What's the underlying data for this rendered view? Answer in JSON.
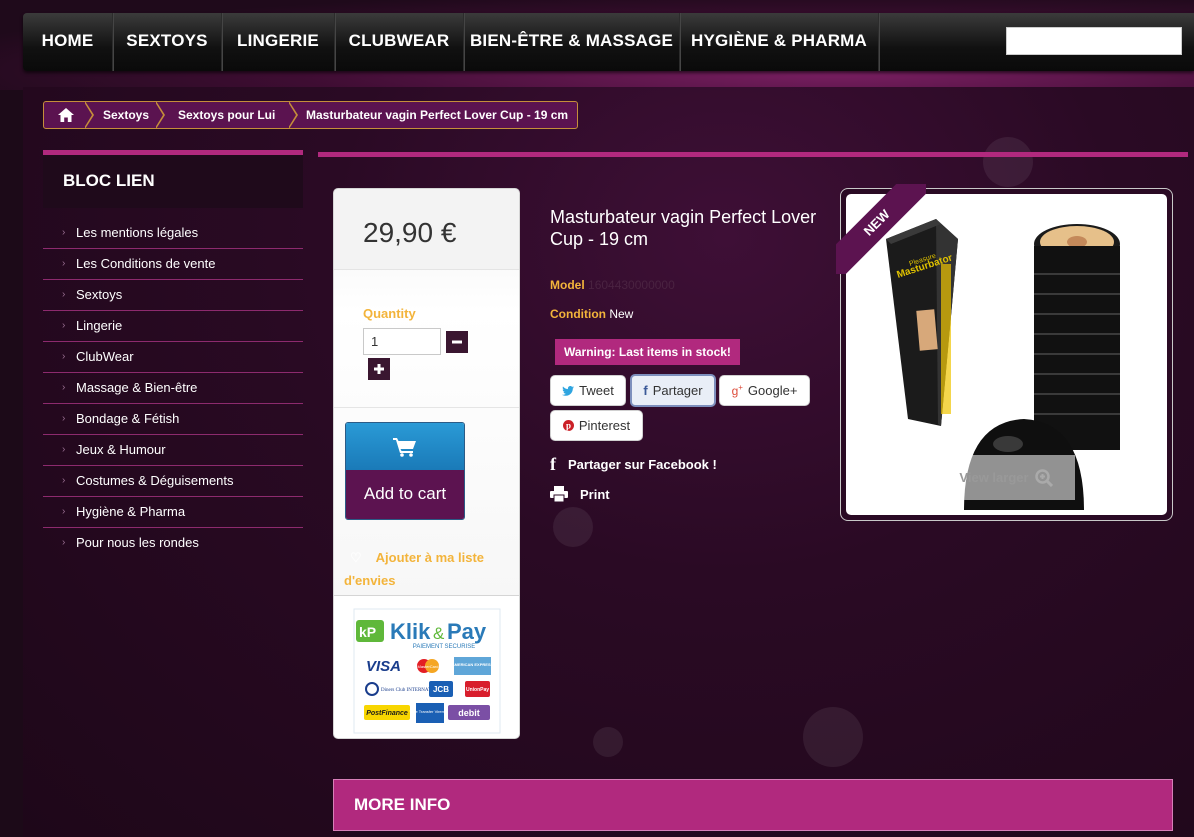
{
  "nav": {
    "items": [
      "HOME",
      "SEXTOYS",
      "LINGERIE",
      "CLUBWEAR",
      "BIEN-ÊTRE & MASSAGE",
      "HYGIÈNE & PHARMA"
    ],
    "search_value": ""
  },
  "breadcrumb": {
    "items": [
      "Sextoys",
      "Sextoys pour Lui",
      "Masturbateur vagin Perfect Lover Cup - 19 cm"
    ]
  },
  "sidebar": {
    "title": "BLOC LIEN",
    "links": [
      "Les mentions légales",
      "Les Conditions de vente",
      "Sextoys",
      "Lingerie",
      "ClubWear",
      "Massage & Bien-être",
      "Bondage & Fétish",
      "Jeux & Humour",
      "Costumes & Déguisements",
      "Hygiène & Pharma",
      "Pour nous les rondes"
    ]
  },
  "buy": {
    "price": "29,90 €",
    "quantity_label": "Quantity",
    "quantity_value": "1",
    "add_to_cart": "Add to cart",
    "wishlist": "Ajouter à ma liste d'envies"
  },
  "payment": {
    "brand_a": "Klik",
    "brand_amp": "&",
    "brand_b": "Pay",
    "tagline": "PAIEMENT SECURISE",
    "cards": [
      "VISA",
      "MasterCard",
      "AMERICAN EXPRESS",
      "Diners Club INTERNATIONAL",
      "JCB",
      "UnionPay",
      "PostFinance",
      "Wire Transfer Virement",
      "debit"
    ]
  },
  "product": {
    "title": "Masturbateur vagin Perfect Lover Cup - 19 cm",
    "model_label": "Model",
    "model_value": "1604430000000",
    "condition_label": "Condition",
    "condition_value": "New",
    "stock_warning": "Warning: Last items in stock!",
    "share": [
      "Tweet",
      "Partager",
      "Google+",
      "Pinterest"
    ],
    "facebook_share": "Partager sur Facebook !",
    "print": "Print",
    "badge": "NEW",
    "view_larger": "View larger",
    "packaging_text": [
      "Pleasure",
      "Masturbator"
    ]
  },
  "more_info": "MORE INFO",
  "colors": {
    "accent": "#b1297e",
    "dark_purple": "#5c1350",
    "label_gold": "#f3b43b",
    "cart_blue": "#2a9ad6"
  }
}
